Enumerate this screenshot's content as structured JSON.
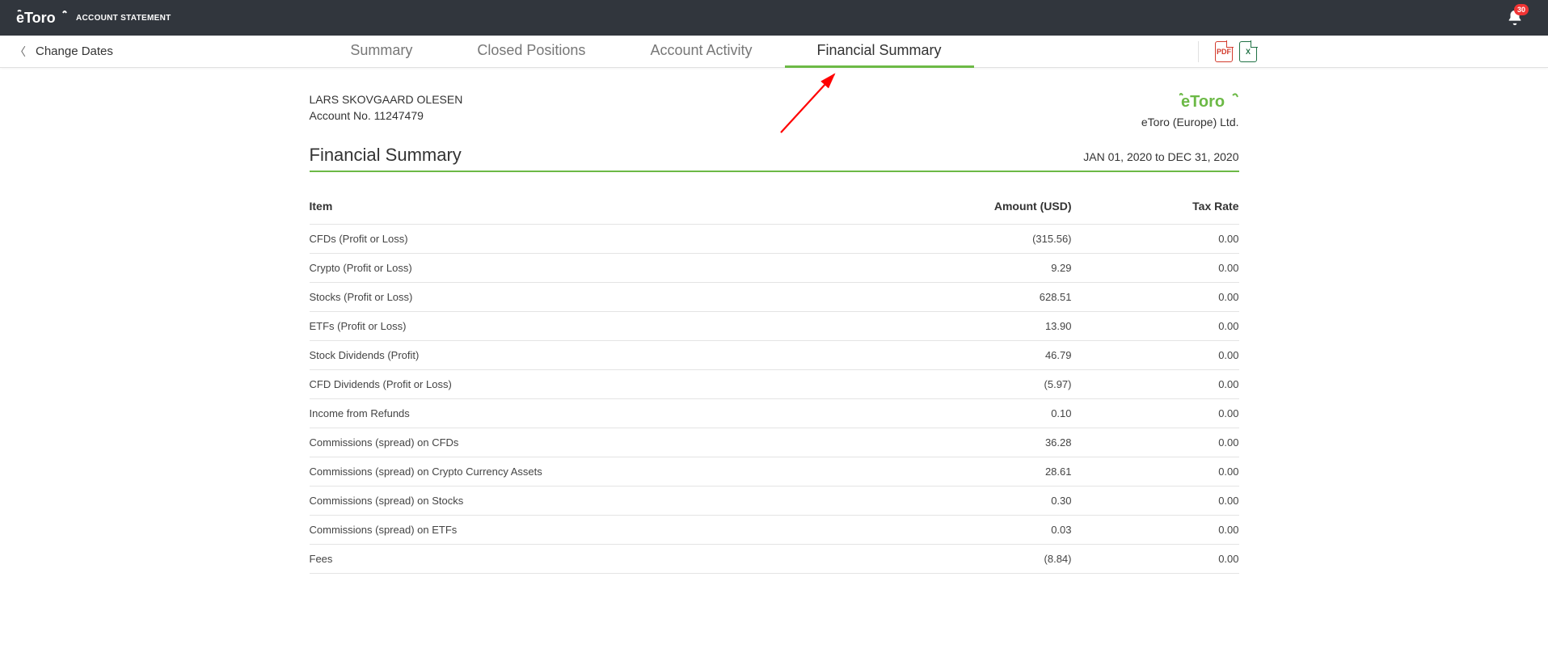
{
  "topbar": {
    "brand": "eToro",
    "title": "ACCOUNT STATEMENT",
    "notif_count": "30"
  },
  "tabbar": {
    "change_dates": "Change Dates",
    "tabs": [
      {
        "label": "Summary"
      },
      {
        "label": "Closed Positions"
      },
      {
        "label": "Account Activity"
      },
      {
        "label": "Financial Summary"
      }
    ],
    "active_index": 3,
    "export_pdf": "PDF",
    "export_xls": "X"
  },
  "meta": {
    "name": "LARS SKOVGAARD OLESEN",
    "account_label": "Account No. 11247479",
    "entity": "eToro (Europe) Ltd."
  },
  "section": {
    "title": "Financial Summary",
    "range": "JAN 01, 2020 to DEC 31, 2020"
  },
  "table": {
    "headers": {
      "item": "Item",
      "amount": "Amount (USD)",
      "rate": "Tax Rate"
    },
    "rows": [
      {
        "item": "CFDs (Profit or Loss)",
        "amount": "(315.56)",
        "rate": "0.00"
      },
      {
        "item": "Crypto (Profit or Loss)",
        "amount": "9.29",
        "rate": "0.00"
      },
      {
        "item": "Stocks (Profit or Loss)",
        "amount": "628.51",
        "rate": "0.00"
      },
      {
        "item": "ETFs (Profit or Loss)",
        "amount": "13.90",
        "rate": "0.00"
      },
      {
        "item": "Stock Dividends (Profit)",
        "amount": "46.79",
        "rate": "0.00"
      },
      {
        "item": "CFD Dividends (Profit or Loss)",
        "amount": "(5.97)",
        "rate": "0.00"
      },
      {
        "item": "Income from Refunds",
        "amount": "0.10",
        "rate": "0.00"
      },
      {
        "item": "Commissions (spread) on CFDs",
        "amount": "36.28",
        "rate": "0.00"
      },
      {
        "item": "Commissions (spread) on Crypto Currency Assets",
        "amount": "28.61",
        "rate": "0.00"
      },
      {
        "item": "Commissions (spread) on Stocks",
        "amount": "0.30",
        "rate": "0.00"
      },
      {
        "item": "Commissions (spread) on ETFs",
        "amount": "0.03",
        "rate": "0.00"
      },
      {
        "item": "Fees",
        "amount": "(8.84)",
        "rate": "0.00"
      }
    ]
  }
}
